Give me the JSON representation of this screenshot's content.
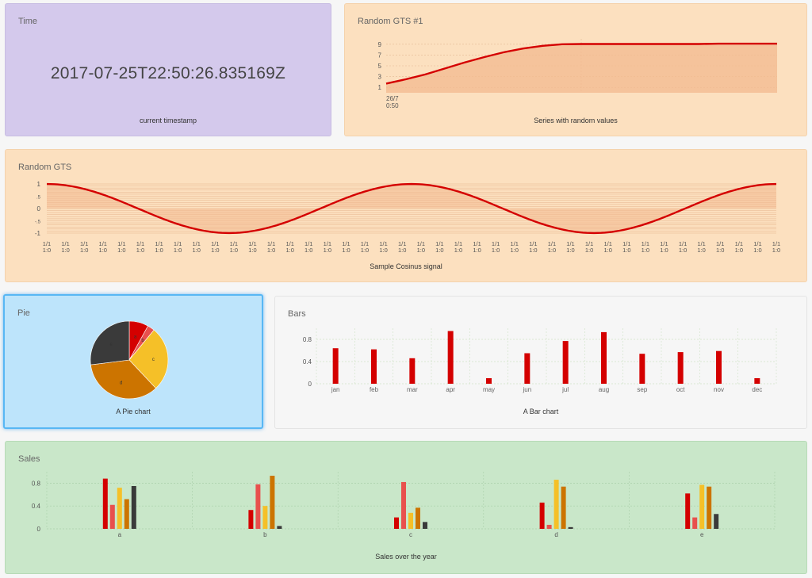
{
  "tiles": {
    "time": {
      "title": "Time",
      "value": "2017-07-25T22:50:26.835169Z",
      "caption": "current timestamp"
    },
    "gts1": {
      "title": "Random GTS #1",
      "caption": "Series with random values"
    },
    "gts": {
      "title": "Random GTS",
      "caption": "Sample Cosinus signal"
    },
    "pie": {
      "title": "Pie",
      "caption": "A Pie chart"
    },
    "bars": {
      "title": "Bars",
      "caption": "A Bar chart"
    },
    "sales": {
      "title": "Sales",
      "caption": "Sales over the year"
    }
  },
  "colors": {
    "line_red": "#d40000",
    "area_orange": "#f3b98f",
    "pie": [
      "#d40000",
      "#e8504d",
      "#f5c028",
      "#cc7400",
      "#3a3a3a"
    ],
    "bar_red": "#d40000",
    "sales": [
      "#d40000",
      "#e8504d",
      "#f5c028",
      "#cc7400",
      "#3a3a3a"
    ]
  },
  "chart_data": [
    {
      "id": "gts1",
      "type": "area",
      "x": [
        "26/7 0:50",
        "",
        "",
        "",
        "",
        "",
        "",
        "",
        "",
        "",
        "",
        "",
        "",
        "",
        "",
        "",
        "",
        "",
        "",
        "",
        ""
      ],
      "x_tick_labels": [
        "26/7",
        "0:50"
      ],
      "values": [
        1.7,
        2.5,
        3.4,
        4.5,
        5.6,
        6.6,
        7.5,
        8.2,
        8.7,
        9.0,
        9.05,
        9.05,
        9.05,
        9.05,
        9.05,
        9.05,
        9.05,
        9.1,
        9.1,
        9.1,
        9.1
      ],
      "y_ticks": [
        "1",
        "3",
        "5",
        "7",
        "9"
      ],
      "ylim": [
        0,
        10
      ],
      "grid": true
    },
    {
      "id": "gts",
      "type": "area",
      "x_tick_label_top": "1/1",
      "x_tick_label_bottom": "1:0",
      "x_tick_count": 40,
      "function": "cosine",
      "cycles": 2,
      "amplitude": 1,
      "y_ticks": [
        "1",
        ".5",
        "0",
        "-.5",
        "-1"
      ],
      "ylim": [
        -1.1,
        1.1
      ],
      "grid": true
    },
    {
      "id": "pie",
      "type": "pie",
      "labels": [
        "a",
        "b",
        "c",
        "d",
        "e"
      ],
      "values": [
        8,
        3,
        27,
        35,
        27
      ]
    },
    {
      "id": "bars",
      "type": "bar",
      "categories": [
        "jan",
        "feb",
        "mar",
        "apr",
        "may",
        "jun",
        "jul",
        "aug",
        "sep",
        "oct",
        "nov",
        "dec"
      ],
      "values": [
        0.64,
        0.62,
        0.46,
        0.95,
        0.1,
        0.55,
        0.77,
        0.93,
        0.54,
        0.57,
        0.59,
        0.1
      ],
      "y_ticks": [
        "0",
        "0.4",
        "0.8"
      ],
      "ylim": [
        0,
        1
      ],
      "grid": true
    },
    {
      "id": "sales",
      "type": "bar",
      "categories": [
        "a",
        "b",
        "c",
        "d",
        "e"
      ],
      "series": [
        {
          "values": [
            0.88,
            0.33,
            0.2,
            0.46,
            0.62
          ]
        },
        {
          "values": [
            0.42,
            0.78,
            0.82,
            0.07,
            0.2
          ]
        },
        {
          "values": [
            0.72,
            0.4,
            0.28,
            0.86,
            0.77
          ]
        },
        {
          "values": [
            0.52,
            0.93,
            0.37,
            0.74,
            0.74
          ]
        },
        {
          "values": [
            0.75,
            0.05,
            0.12,
            0.03,
            0.26
          ]
        }
      ],
      "y_ticks": [
        "0",
        "0.4",
        "0.8"
      ],
      "ylim": [
        0,
        1
      ],
      "grid": true
    }
  ]
}
